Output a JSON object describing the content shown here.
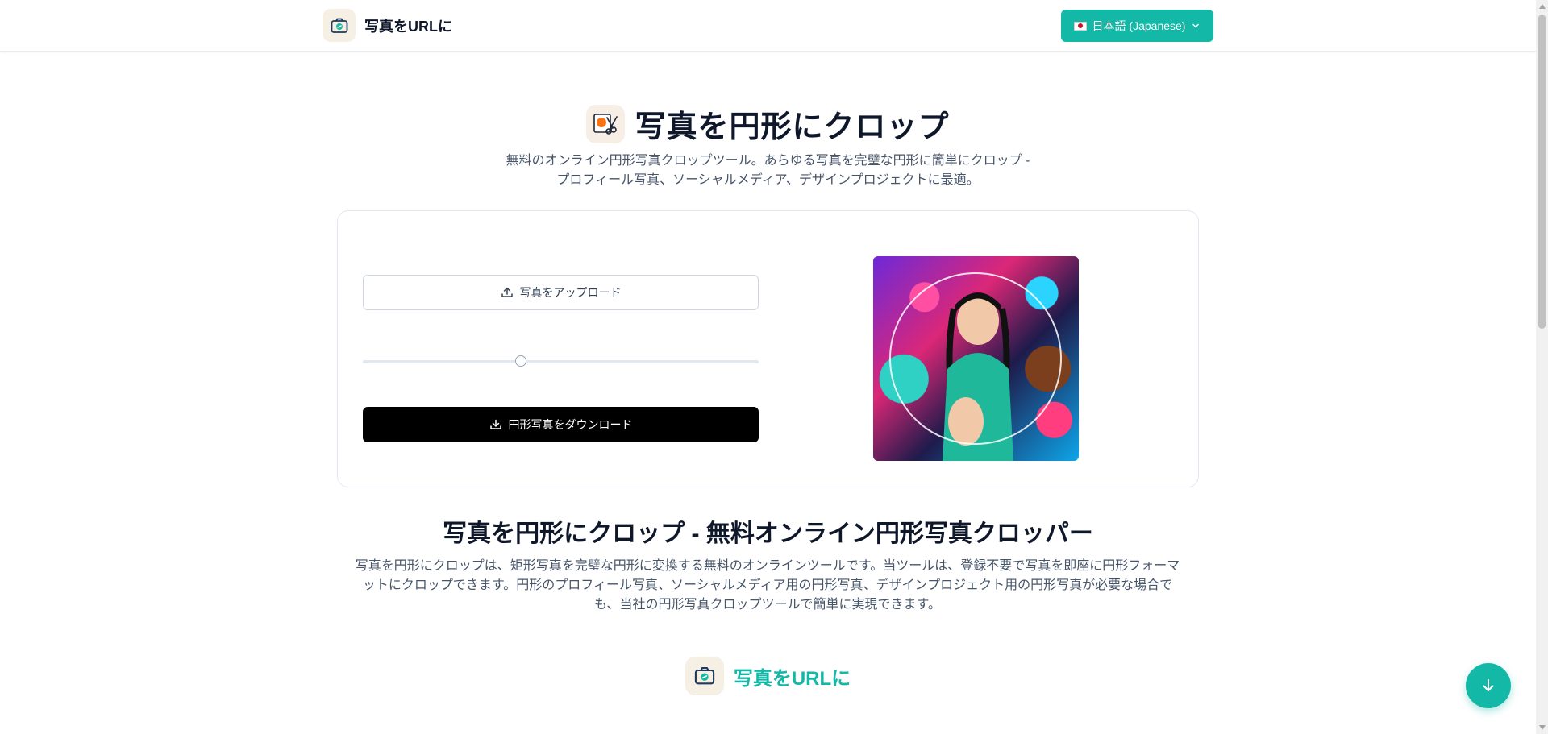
{
  "header": {
    "brand": "写真をURLに",
    "language_button": "日本語 (Japanese)"
  },
  "hero": {
    "title": "写真を円形にクロップ",
    "subtitle_line1": "無料のオンライン円形写真クロップツール。あらゆる写真を完璧な円形に簡単にクロップ -",
    "subtitle_line2": "プロフィール写真、ソーシャルメディア、デザインプロジェクトに最適。"
  },
  "tool": {
    "upload_label": "写真をアップロード",
    "zoom_slider": {
      "value": 0.4
    },
    "download_label": "円形写真をダウンロード"
  },
  "section": {
    "title": "写真を円形にクロップ - 無料オンライン円形写真クロッパー",
    "text_line1": "写真を円形にクロップは、矩形写真を完璧な円形に変換する無料のオンラインツールです。当ツールは、登録不要で写真を即座に円形フォーマ",
    "text_line2": "ットにクロップできます。円形のプロフィール写真、ソーシャルメディア用の円形写真、デザインプロジェクト用の円形写真が必要な場合で",
    "text_line3": "も、当社の円形写真クロップツールで簡単に実現できます。"
  },
  "footer": {
    "brand": "写真をURLに"
  },
  "colors": {
    "accent": "#14b8a6",
    "text_primary": "#0f172a",
    "text_secondary": "#475569",
    "download_button_bg": "#000000"
  },
  "icons": {
    "brand": "camera-link-icon",
    "hero": "scissors-photo-icon",
    "upload": "upload-icon",
    "download": "download-icon",
    "language_dropdown": "chevron-down-icon",
    "flag": "japan-flag-icon",
    "scroll_down": "arrow-down-icon"
  }
}
